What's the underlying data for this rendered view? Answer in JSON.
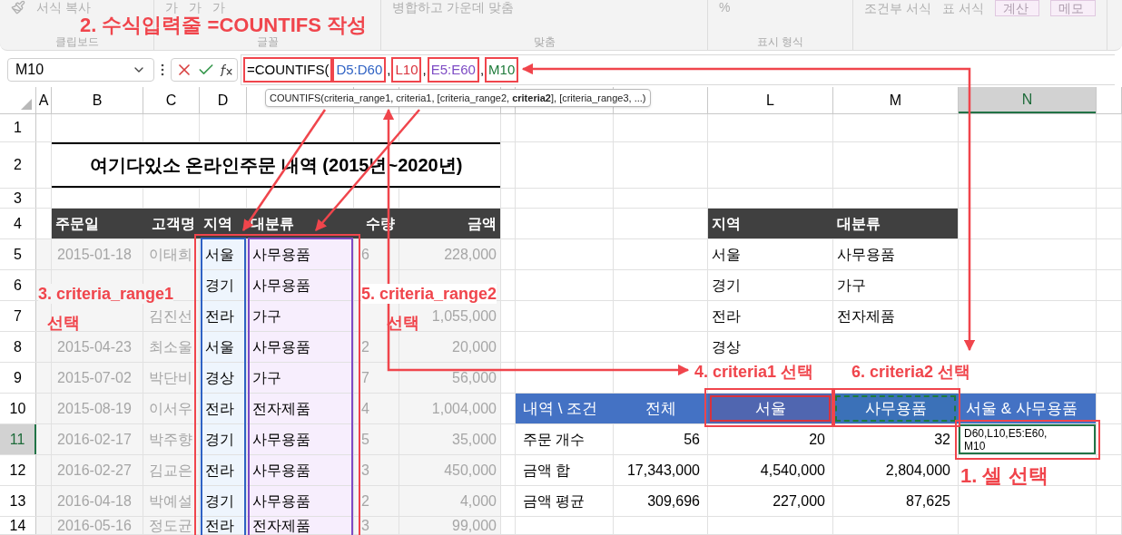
{
  "ribbon": {
    "groups": [
      {
        "label": "클립보드",
        "items": [
          "서식 복사"
        ]
      },
      {
        "label": "글꼴",
        "items": [
          "가",
          "가",
          "가"
        ]
      },
      {
        "label": "맞춤",
        "items": [
          "병합하고 가운데 맞춤"
        ]
      },
      {
        "label": "표시 형식",
        "items": [
          "%"
        ]
      },
      {
        "items": [
          "조건부 서식",
          "표 서식"
        ]
      }
    ],
    "styles": [
      "계산",
      "메모"
    ]
  },
  "formula_bar": {
    "name_box": "M10",
    "tokens": [
      {
        "text": "=COUNTIFS(",
        "color": "#000000",
        "boxed": true
      },
      {
        "text": "D5:D60",
        "color": "#2f62c4",
        "boxed": true
      },
      {
        "text": ",",
        "boxed": false
      },
      {
        "text": "L10",
        "color": "#d8323c",
        "boxed": true
      },
      {
        "text": ",",
        "boxed": false
      },
      {
        "text": "E5:E60",
        "color": "#7d4bc4",
        "boxed": true
      },
      {
        "text": ",",
        "boxed": false
      },
      {
        "text": "M10",
        "color": "#1e7b3a",
        "boxed": true
      }
    ]
  },
  "tooltip": "COUNTIFS(criteria_range1, criteria1, [criteria_range2, **criteria2**], [criteria_range3, ...)",
  "column_headers": [
    {
      "label": "A",
      "selected": false
    },
    {
      "label": "B",
      "selected": false
    },
    {
      "label": "C",
      "selected": false
    },
    {
      "label": "D",
      "selected": false
    },
    {
      "label": "L",
      "selected": false
    },
    {
      "label": "M",
      "selected": false
    },
    {
      "label": "N",
      "selected": true
    }
  ],
  "row_headers": [
    {
      "label": "1",
      "selected": false
    },
    {
      "label": "2",
      "selected": false
    },
    {
      "label": "3",
      "selected": false
    },
    {
      "label": "4",
      "selected": false
    },
    {
      "label": "5",
      "selected": false
    },
    {
      "label": "6",
      "selected": false
    },
    {
      "label": "7",
      "selected": false
    },
    {
      "label": "8",
      "selected": false
    },
    {
      "label": "9",
      "selected": false
    },
    {
      "label": "10",
      "selected": false
    },
    {
      "label": "11",
      "selected": true
    },
    {
      "label": "12",
      "selected": false
    },
    {
      "label": "13",
      "selected": false
    },
    {
      "label": "14",
      "selected": false
    }
  ],
  "title": "여기다있소 온라인주문 내역 (2015년~2020년)",
  "orders": {
    "columns": [
      {
        "label": "주문일"
      },
      {
        "label": "고객명"
      },
      {
        "label": "지역",
        "color": "#2f62c4"
      },
      {
        "label": "대분류",
        "color": "#7d4bc4"
      },
      {
        "label": "수량"
      },
      {
        "label": "금액"
      }
    ],
    "rows": [
      {
        "date": "2015-01-18",
        "customer": "이태희",
        "region": "서울",
        "category": "사무용품",
        "quantity": "6",
        "amount": "228,000"
      },
      {
        "region": "경기",
        "category": "사무용품"
      },
      {
        "customer": "김진선",
        "region": "전라",
        "category": "가구",
        "amount": "1,055,000"
      },
      {
        "date": "2015-04-23",
        "customer": "최소울",
        "region": "서울",
        "category": "사무용품",
        "quantity": "2",
        "amount": "20,000"
      },
      {
        "date": "2015-07-02",
        "customer": "박단비",
        "region": "경상",
        "category": "가구",
        "quantity": "7",
        "amount": "56,000"
      },
      {
        "date": "2015-08-19",
        "customer": "이서우",
        "region": "전라",
        "category": "전자제품",
        "quantity": "4",
        "amount": "1,004,000"
      },
      {
        "date": "2016-02-17",
        "customer": "박주향",
        "region": "경기",
        "category": "사무용품",
        "quantity": "5",
        "amount": "35,000"
      },
      {
        "date": "2016-02-27",
        "customer": "김교은",
        "region": "전라",
        "category": "사무용품",
        "quantity": "3",
        "amount": "450,000"
      },
      {
        "date": "2016-04-18",
        "customer": "박예설",
        "region": "경기",
        "category": "사무용품",
        "quantity": "2",
        "amount": "4,000"
      },
      {
        "date": "2016-05-16",
        "customer": "정도균",
        "region": "전라",
        "category": "전자제품",
        "quantity": "3",
        "amount": "99,000"
      }
    ]
  },
  "lookup": {
    "columns": [
      "지역",
      "대분류"
    ],
    "rows": [
      {
        "region": "서울",
        "category": "사무용품"
      },
      {
        "region": "경기",
        "category": "가구"
      },
      {
        "region": "전라",
        "category": "전자제품"
      },
      {
        "region": "경상"
      }
    ]
  },
  "summary": {
    "header": [
      {
        "text": "내역 \\ 조건",
        "color": "#4472c4",
        "referenced": false
      },
      {
        "text": "전체",
        "color": "#4472c4",
        "referenced": false
      },
      {
        "text": "서울",
        "color": "#5066b0",
        "referenced": true,
        "editing": false
      },
      {
        "text": "사무용품",
        "color": "#3b71b8",
        "referenced": true,
        "editing": true
      },
      {
        "text": "서울 & 사무용품",
        "color": "#4472c4",
        "referenced": false
      }
    ],
    "rows": [
      {
        "cells": [
          "주문 개수",
          "56",
          "20",
          "32"
        ]
      },
      {
        "cells": [
          "금액 합",
          "17,343,000",
          "4,540,000",
          "2,804,000"
        ]
      },
      {
        "cells": [
          "금액 평균",
          "309,696",
          "227,000",
          "87,625"
        ]
      }
    ],
    "editing_cell": {
      "lines": [
        "D60,L10,E5:E60,",
        "M10"
      ]
    }
  },
  "annotations": [
    "1. 셀 선택",
    "2. 수식입력줄 =COUNTIFS 작성",
    "3. criteria_range1",
    "선택",
    "4. criteria1 선택",
    "5. criteria_range2",
    "선택",
    "6. criteria2 선택"
  ]
}
